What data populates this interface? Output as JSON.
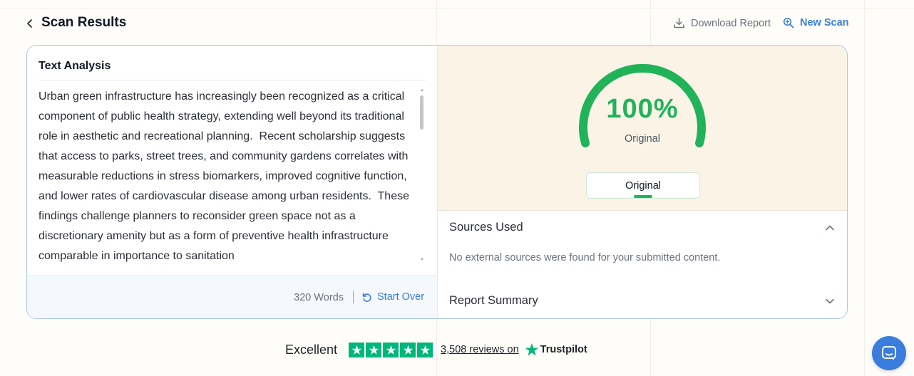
{
  "header": {
    "title": "Scan Results",
    "download_label": "Download Report",
    "new_scan_label": "New Scan"
  },
  "text_analysis": {
    "title": "Text Analysis",
    "content": "Urban green infrastructure has increasingly been recognized as a critical component of public health strategy, extending well beyond its traditional role in aesthetic and recreational planning.  Recent scholarship suggests that access to parks, street trees, and community gardens correlates with measurable reductions in stress biomarkers, improved cognitive function, and lower rates of cardiovascular disease among urban residents.  These findings challenge planners to reconsider green space not as a discretionary amenity but as a form of preventive health infrastructure comparable in importance to sanitation",
    "word_count": "320 Words",
    "start_over_label": "Start Over"
  },
  "score": {
    "percent": "100%",
    "percent_value": 1.0,
    "label": "Original",
    "tab_label": "Original",
    "color": "#21b35a"
  },
  "sources": {
    "title": "Sources Used",
    "empty_message": "No external sources were found for your submitted content."
  },
  "summary": {
    "title": "Report Summary"
  },
  "trustpilot": {
    "rating_label": "Excellent",
    "reviews_link": "3,508 reviews on",
    "brand": "Trustpilot",
    "stars": 5
  },
  "colors": {
    "accent": "#3b7ddd",
    "success": "#21b35a",
    "trustpilot": "#00b67a"
  }
}
